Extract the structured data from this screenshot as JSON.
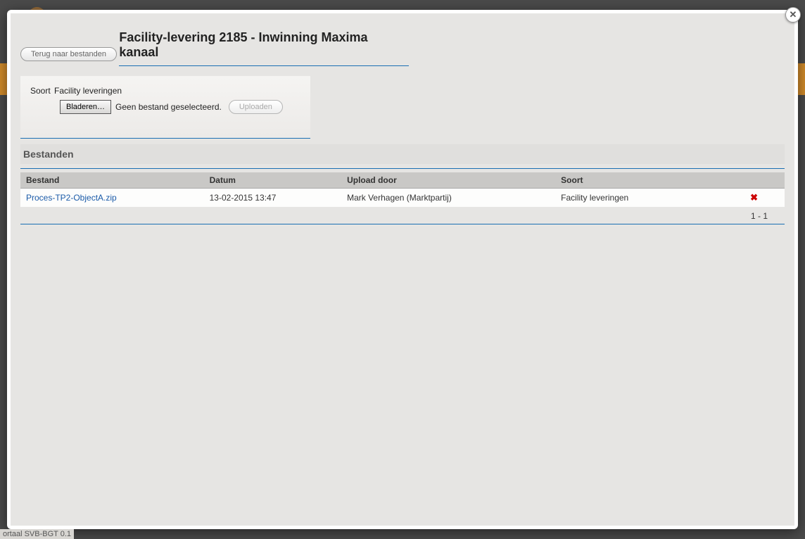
{
  "footer": "ortaal SVB-BGT 0.1",
  "modal": {
    "close_glyph": "✕",
    "back_label": "Terug naar bestanden",
    "page_title": "Facility-levering 2185 - Inwinning Maxima kanaal",
    "soort_label": "Soort",
    "soort_value": "Facility leveringen",
    "browse_label": "Bladeren…",
    "no_file_text": "Geen bestand geselecteerd.",
    "upload_label": "Uploaden",
    "files_section_title": "Bestanden",
    "columns": {
      "bestand": "Bestand",
      "datum": "Datum",
      "upload_door": "Upload door",
      "soort": "Soort"
    },
    "rows": [
      {
        "bestand": "Proces-TP2-ObjectA.zip",
        "datum": "13-02-2015 13:47",
        "upload_door": "Mark Verhagen (Marktpartij)",
        "soort": "Facility leveringen",
        "delete_glyph": "✖"
      }
    ],
    "pager_text": "1 - 1"
  }
}
